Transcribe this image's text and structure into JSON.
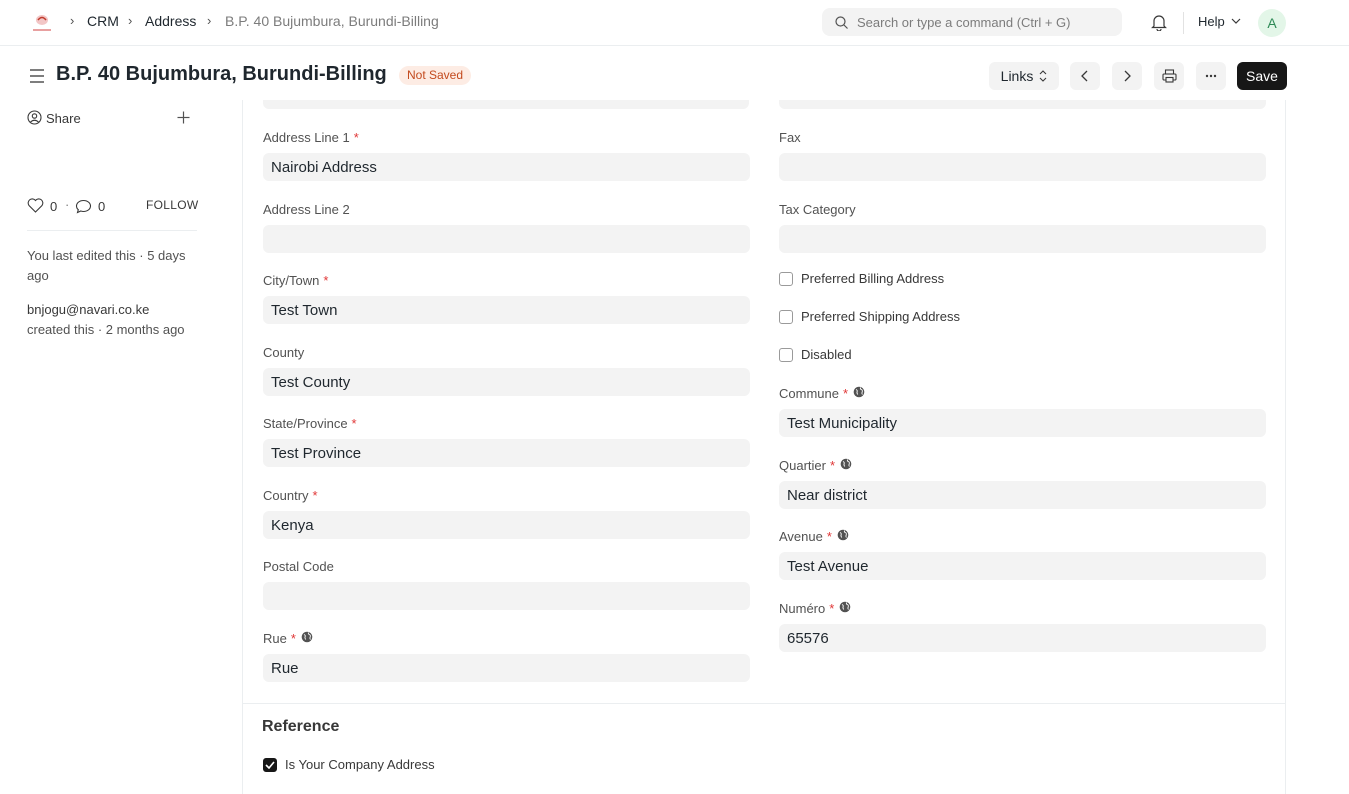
{
  "navbar": {
    "breadcrumbs": [
      "CRM",
      "Address",
      "B.P. 40 Bujumbura, Burundi-Billing"
    ],
    "search_placeholder": "Search or type a command (Ctrl + G)",
    "help_label": "Help",
    "avatar_initial": "A"
  },
  "page": {
    "title": "B.P. 40 Bujumbura, Burundi-Billing",
    "status": "Not Saved",
    "links_label": "Links",
    "save_label": "Save"
  },
  "sidebar": {
    "share_label": "Share",
    "likes_count": "0",
    "comments_count": "0",
    "follow_label": "FOLLOW",
    "last_edited": "You last edited this · 5 days ago",
    "creator": "bnjogu@navari.co.ke",
    "created": "created this · 2 months ago"
  },
  "left_fields": [
    {
      "label": "Address Line 1",
      "required": true,
      "globe": false,
      "value": "Nairobi Address"
    },
    {
      "label": "Address Line 2",
      "required": false,
      "globe": false,
      "value": ""
    },
    {
      "label": "City/Town",
      "required": true,
      "globe": false,
      "value": "Test Town"
    },
    {
      "label": "County",
      "required": false,
      "globe": false,
      "value": "Test County"
    },
    {
      "label": "State/Province",
      "required": true,
      "globe": false,
      "value": "Test Province"
    },
    {
      "label": "Country",
      "required": true,
      "globe": false,
      "value": "Kenya"
    },
    {
      "label": "Postal Code",
      "required": false,
      "globe": false,
      "value": ""
    },
    {
      "label": "Rue",
      "required": true,
      "globe": true,
      "value": "Rue"
    }
  ],
  "right_fields_top": [
    {
      "label": "Fax",
      "required": false,
      "globe": false,
      "value": ""
    },
    {
      "label": "Tax Category",
      "required": false,
      "globe": false,
      "value": ""
    }
  ],
  "checkboxes": [
    {
      "label": "Preferred Billing Address",
      "checked": false
    },
    {
      "label": "Preferred Shipping Address",
      "checked": false
    },
    {
      "label": "Disabled",
      "checked": false
    }
  ],
  "right_fields_bottom": [
    {
      "label": "Commune",
      "required": true,
      "globe": true,
      "value": "Test Municipality"
    },
    {
      "label": "Quartier",
      "required": true,
      "globe": true,
      "value": "Near district"
    },
    {
      "label": "Avenue",
      "required": true,
      "globe": true,
      "value": "Test Avenue"
    },
    {
      "label": "Numéro",
      "required": true,
      "globe": true,
      "value": "65576"
    }
  ],
  "reference": {
    "title": "Reference",
    "company_address_label": "Is Your Company Address",
    "company_address_checked": true
  },
  "colors": {
    "accent": "#171717",
    "status_bg": "#fdece4",
    "status_text": "#c34a1e",
    "required": "#e03636",
    "input_bg": "#f3f3f3"
  }
}
